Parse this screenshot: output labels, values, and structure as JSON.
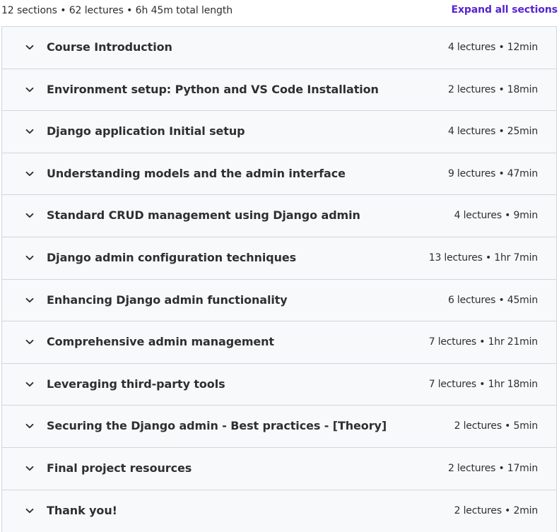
{
  "summary": {
    "text": "12 sections • 62 lectures • 6h 45m total length",
    "expand_label": "Expand all sections"
  },
  "colors": {
    "link": "#5624d0",
    "row_background": "#f7f9fa",
    "border": "#d1d7dc",
    "text": "#2d2f31"
  },
  "sections": [
    {
      "title": "Course Introduction",
      "meta": "4 lectures • 12min",
      "icon": "chevron-down-icon"
    },
    {
      "title": "Environment setup: Python and VS Code Installation",
      "meta": "2 lectures • 18min",
      "icon": "chevron-down-icon"
    },
    {
      "title": "Django application Initial setup",
      "meta": "4 lectures • 25min",
      "icon": "chevron-down-icon"
    },
    {
      "title": "Understanding models and the admin interface",
      "meta": "9 lectures • 47min",
      "icon": "chevron-down-icon"
    },
    {
      "title": "Standard CRUD management using Django admin",
      "meta": "4 lectures • 9min",
      "icon": "chevron-down-icon"
    },
    {
      "title": "Django admin configuration techniques",
      "meta": "13 lectures • 1hr 7min",
      "icon": "chevron-down-icon"
    },
    {
      "title": "Enhancing Django admin functionality",
      "meta": "6 lectures • 45min",
      "icon": "chevron-down-icon"
    },
    {
      "title": "Comprehensive admin management",
      "meta": "7 lectures • 1hr 21min",
      "icon": "chevron-down-icon"
    },
    {
      "title": "Leveraging third-party tools",
      "meta": "7 lectures • 1hr 18min",
      "icon": "chevron-down-icon"
    },
    {
      "title": "Securing the Django admin - Best practices - [Theory]",
      "meta": "2 lectures • 5min",
      "icon": "chevron-down-icon"
    },
    {
      "title": "Final project resources",
      "meta": "2 lectures • 17min",
      "icon": "chevron-down-icon"
    },
    {
      "title": "Thank you!",
      "meta": "2 lectures • 2min",
      "icon": "chevron-down-icon"
    }
  ]
}
